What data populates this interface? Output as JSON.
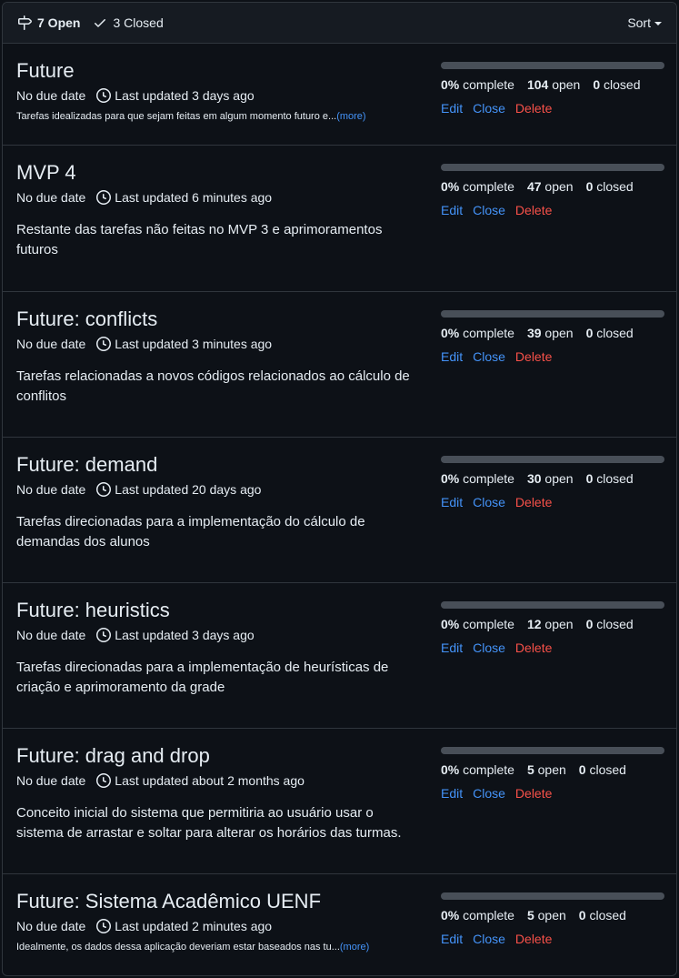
{
  "header": {
    "open_label": "7 Open",
    "closed_label": "3 Closed",
    "sort_label": "Sort"
  },
  "milestones": [
    {
      "title": "Future",
      "due": "No due date",
      "updated": "Last updated 3 days ago",
      "description": "Tarefas idealizadas para que sejam feitas em algum momento futuro e...",
      "more": "(more)",
      "progress": 0,
      "percent": "0%",
      "complete_label": "complete",
      "open": "104",
      "open_label": "open",
      "closed": "0",
      "closed_label": "closed",
      "edit": "Edit",
      "close": "Close",
      "delete": "Delete"
    },
    {
      "title": "MVP 4",
      "due": "No due date",
      "updated": "Last updated 6 minutes ago",
      "description": "Restante das tarefas não feitas no MVP 3 e aprimoramentos futuros",
      "progress": 0,
      "percent": "0%",
      "complete_label": "complete",
      "open": "47",
      "open_label": "open",
      "closed": "0",
      "closed_label": "closed",
      "edit": "Edit",
      "close": "Close",
      "delete": "Delete"
    },
    {
      "title": "Future: conflicts",
      "due": "No due date",
      "updated": "Last updated 3 minutes ago",
      "description": "Tarefas relacionadas a novos códigos relacionados ao cálculo de conflitos",
      "progress": 0,
      "percent": "0%",
      "complete_label": "complete",
      "open": "39",
      "open_label": "open",
      "closed": "0",
      "closed_label": "closed",
      "edit": "Edit",
      "close": "Close",
      "delete": "Delete"
    },
    {
      "title": "Future: demand",
      "due": "No due date",
      "updated": "Last updated 20 days ago",
      "description": "Tarefas direcionadas para a implementação do cálculo de demandas dos alunos",
      "progress": 0,
      "percent": "0%",
      "complete_label": "complete",
      "open": "30",
      "open_label": "open",
      "closed": "0",
      "closed_label": "closed",
      "edit": "Edit",
      "close": "Close",
      "delete": "Delete"
    },
    {
      "title": "Future: heuristics",
      "due": "No due date",
      "updated": "Last updated 3 days ago",
      "description": "Tarefas direcionadas para a implementação de heurísticas de criação e aprimoramento da grade",
      "progress": 0,
      "percent": "0%",
      "complete_label": "complete",
      "open": "12",
      "open_label": "open",
      "closed": "0",
      "closed_label": "closed",
      "edit": "Edit",
      "close": "Close",
      "delete": "Delete"
    },
    {
      "title": "Future: drag and drop",
      "due": "No due date",
      "updated": "Last updated about 2 months ago",
      "description": "Conceito inicial do sistema que permitiria ao usuário usar o sistema de arrastar e soltar para alterar os horários das turmas.",
      "progress": 0,
      "percent": "0%",
      "complete_label": "complete",
      "open": "5",
      "open_label": "open",
      "closed": "0",
      "closed_label": "closed",
      "edit": "Edit",
      "close": "Close",
      "delete": "Delete"
    },
    {
      "title": "Future: Sistema Acadêmico UENF",
      "due": "No due date",
      "updated": "Last updated 2 minutes ago",
      "description": "Idealmente, os dados dessa aplicação deveriam estar baseados nas tu...",
      "more": "(more)",
      "progress": 0,
      "percent": "0%",
      "complete_label": "complete",
      "open": "5",
      "open_label": "open",
      "closed": "0",
      "closed_label": "closed",
      "edit": "Edit",
      "close": "Close",
      "delete": "Delete"
    }
  ]
}
